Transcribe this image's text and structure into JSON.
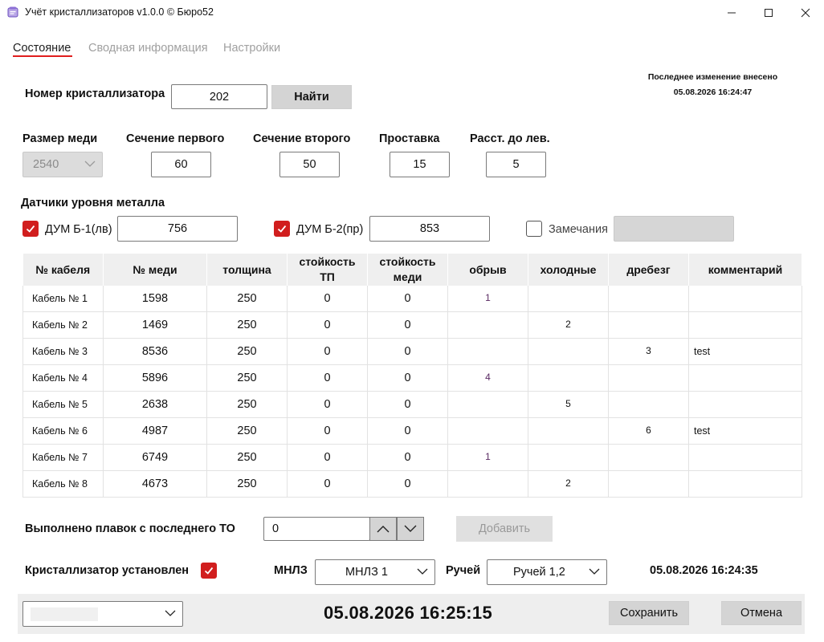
{
  "window": {
    "title": "Учёт кристаллизаторов v1.0.0 © Бюро52",
    "minimize_glyph": "—",
    "maximize_glyph": "☐",
    "close_glyph": "✕"
  },
  "tabs": [
    {
      "label": "Состояние",
      "active": true
    },
    {
      "label": "Сводная информация",
      "active": false
    },
    {
      "label": "Настройки",
      "active": false
    }
  ],
  "last_change": {
    "label": "Последнее изменение внесено",
    "timestamp": "05.08.2026 16:24:47"
  },
  "search": {
    "label": "Номер кристаллизатора",
    "value": "202",
    "button_label": "Найти"
  },
  "params": {
    "copper_size": {
      "label": "Размер меди",
      "value": "2540"
    },
    "section_first": {
      "label": "Сечение первого",
      "value": "60"
    },
    "section_second": {
      "label": "Сечение второго",
      "value": "50"
    },
    "spacer": {
      "label": "Проставка",
      "value": "15"
    },
    "dist_left": {
      "label": "Расст. до лев.",
      "value": "5"
    }
  },
  "sensors": {
    "title": "Датчики уровня металла",
    "left": {
      "label": "ДУМ Б-1(лв)",
      "checked": true,
      "value": "756"
    },
    "right": {
      "label": "ДУМ Б-2(пр)",
      "checked": true,
      "value": "853"
    },
    "remarks": {
      "label": "Замечания",
      "checked": false,
      "value": ""
    }
  },
  "table": {
    "headers": [
      [
        "№ кабеля"
      ],
      [
        "№ меди"
      ],
      [
        "толщина"
      ],
      [
        "стойкость",
        "ТП"
      ],
      [
        "стойкость",
        "меди"
      ],
      [
        "обрыв"
      ],
      [
        "холодные"
      ],
      [
        "дребезг"
      ],
      [
        "комментарий"
      ]
    ],
    "rows": [
      {
        "name": "Кабель № 1",
        "copper": "1598",
        "thickness": "250",
        "res_tp": "0",
        "res_copper": "0",
        "break": "1",
        "cold": "",
        "bounce": "",
        "comment": ""
      },
      {
        "name": "Кабель № 2",
        "copper": "1469",
        "thickness": "250",
        "res_tp": "0",
        "res_copper": "0",
        "break": "",
        "cold": "2",
        "bounce": "",
        "comment": ""
      },
      {
        "name": "Кабель № 3",
        "copper": "8536",
        "thickness": "250",
        "res_tp": "0",
        "res_copper": "0",
        "break": "",
        "cold": "",
        "bounce": "3",
        "comment": "test"
      },
      {
        "name": "Кабель № 4",
        "copper": "5896",
        "thickness": "250",
        "res_tp": "0",
        "res_copper": "0",
        "break": "4",
        "cold": "",
        "bounce": "",
        "comment": ""
      },
      {
        "name": "Кабель № 5",
        "copper": "2638",
        "thickness": "250",
        "res_tp": "0",
        "res_copper": "0",
        "break": "",
        "cold": "5",
        "bounce": "",
        "comment": ""
      },
      {
        "name": "Кабель № 6",
        "copper": "4987",
        "thickness": "250",
        "res_tp": "0",
        "res_copper": "0",
        "break": "",
        "cold": "",
        "bounce": "6",
        "comment": "test"
      },
      {
        "name": "Кабель № 7",
        "copper": "6749",
        "thickness": "250",
        "res_tp": "0",
        "res_copper": "0",
        "break": "1",
        "cold": "",
        "bounce": "",
        "comment": ""
      },
      {
        "name": "Кабель № 8",
        "copper": "4673",
        "thickness": "250",
        "res_tp": "0",
        "res_copper": "0",
        "break": "",
        "cold": "2",
        "bounce": "",
        "comment": ""
      }
    ]
  },
  "heats": {
    "label": "Выполнено плавок с последнего ТО",
    "value": "0",
    "add_button": "Добавить"
  },
  "install": {
    "label": "Кристаллизатор установлен",
    "checked": true,
    "mnlz_label": "МНЛЗ",
    "mnlz_value": "МНЛЗ 1",
    "stream_label": "Ручей",
    "stream_value": "Ручей 1,2",
    "timestamp": "05.08.2026 16:24:35"
  },
  "footer": {
    "selector_value": "",
    "clock": "05.08.2026 16:25:15",
    "save_button": "Сохранить",
    "cancel_button": "Отмена"
  },
  "colors": {
    "accent_red": "#d11e1e",
    "button_gray": "#d4d4d4",
    "header_gray": "#efefef"
  }
}
